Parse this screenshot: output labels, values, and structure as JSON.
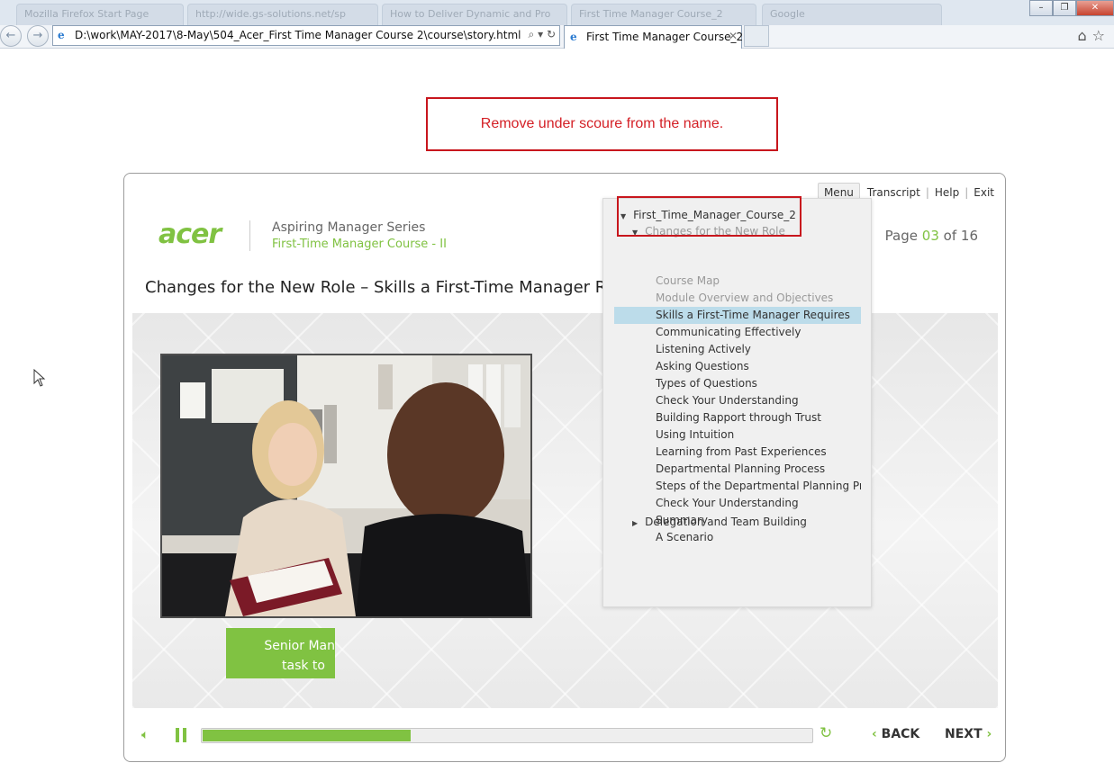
{
  "browser": {
    "background_tabs": [
      "Mozilla Firefox Start Page",
      "http://wide.gs-solutions.net/sp",
      "How to Deliver Dynamic and Pro",
      "First Time Manager Course_2",
      "Google"
    ],
    "address_url": "D:\\work\\MAY-2017\\8-May\\504_Acer_First Time Manager Course 2\\course\\story.html",
    "active_tab_title": "First Time Manager Course_2",
    "icons": {
      "back": "back-arrow-icon",
      "forward": "forward-arrow-icon",
      "search": "search-icon",
      "refresh": "refresh-icon",
      "home": "home-icon",
      "favorites": "star-icon",
      "settings": "gear-icon"
    }
  },
  "annotation": {
    "note_text": "Remove under scoure from the name.",
    "color": "#c8161d"
  },
  "player": {
    "top_menu": {
      "menu": "Menu",
      "transcript": "Transcript",
      "help": "Help",
      "exit": "Exit"
    },
    "logo_text": "acer",
    "series_title": "Aspiring Manager Series",
    "course_title": "First-Time Manager Course - II",
    "page": {
      "label": "Page",
      "current": "03",
      "of": "of",
      "total": "16"
    },
    "slide_title": "Changes for the New Role – Skills a First-Time Manager Rec",
    "green_button_lines": [
      "Senior Mana",
      "task to"
    ],
    "controls": {
      "back": "BACK",
      "next": "NEXT",
      "progress": 0.34
    },
    "accent_color": "#80c242"
  },
  "menu_panel": {
    "root": "First_Time_Manager_Course_2",
    "section_open": "Changes for the New Role",
    "items": [
      {
        "label": "Course Map",
        "state": "visited"
      },
      {
        "label": "Module Overview and Objectives",
        "state": "visited"
      },
      {
        "label": "Skills a First-Time Manager Requires",
        "state": "selected"
      },
      {
        "label": "Communicating Effectively",
        "state": "normal"
      },
      {
        "label": "Listening Actively",
        "state": "normal"
      },
      {
        "label": "Asking Questions",
        "state": "normal"
      },
      {
        "label": "Types of Questions",
        "state": "normal"
      },
      {
        "label": "Check Your Understanding",
        "state": "normal"
      },
      {
        "label": "Building Rapport through Trust",
        "state": "normal"
      },
      {
        "label": "Using Intuition",
        "state": "normal"
      },
      {
        "label": "Learning from Past Experiences",
        "state": "normal"
      },
      {
        "label": "Departmental Planning Process",
        "state": "normal"
      },
      {
        "label": "Steps of the Departmental Planning Pro...",
        "state": "normal"
      },
      {
        "label": "Check Your Understanding",
        "state": "normal"
      },
      {
        "label": "Summary",
        "state": "normal"
      },
      {
        "label": "A Scenario",
        "state": "normal"
      }
    ],
    "section_closed": "Delegation and Team Building"
  }
}
